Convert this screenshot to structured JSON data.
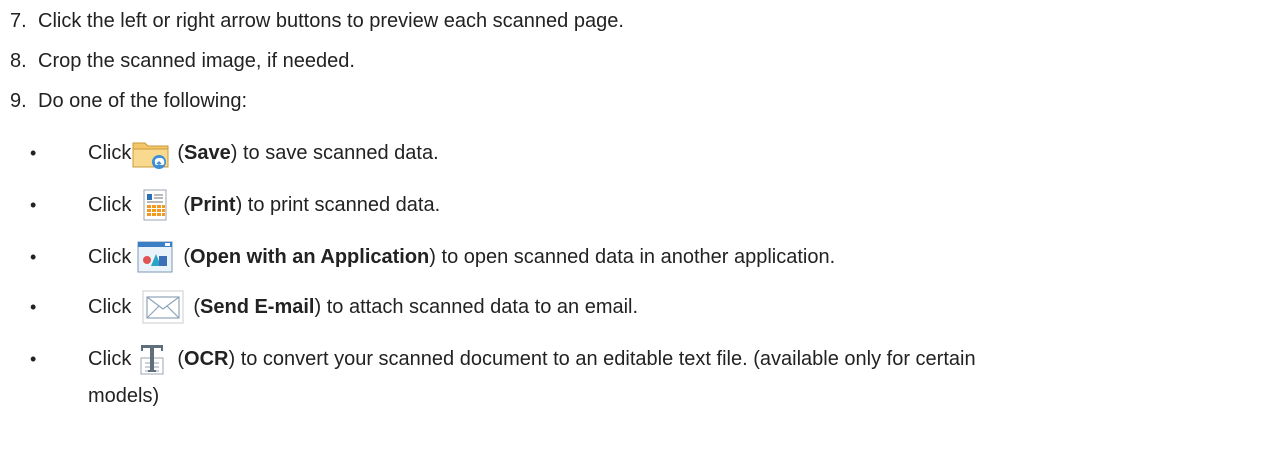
{
  "steps": [
    {
      "number": "7.",
      "text": "Click the left or right arrow buttons to preview each scanned page."
    },
    {
      "number": "8.",
      "text": "Crop the scanned image, if needed."
    },
    {
      "number": "9.",
      "text": "Do one of the following:"
    }
  ],
  "options": [
    {
      "bullet": "•",
      "click": "Click",
      "icon": "folder-save-icon",
      "open": "(",
      "name": "Save",
      "close": ")",
      "rest": " to save scanned data."
    },
    {
      "bullet": "•",
      "click": "Click",
      "icon": "print-icon",
      "open": "(",
      "name": "Print",
      "close": ")",
      "rest": " to print scanned data."
    },
    {
      "bullet": "•",
      "click": "Click",
      "icon": "open-application-icon",
      "open": "(",
      "name": "Open with an Application",
      "close": ")",
      "rest": " to open scanned data in another application."
    },
    {
      "bullet": "•",
      "click": "Click",
      "icon": "email-envelope-icon",
      "open": "(",
      "name": "Send E-mail",
      "close": ")",
      "rest": " to attach scanned data to an email."
    },
    {
      "bullet": "•",
      "click": "Click",
      "icon": "ocr-text-icon",
      "open": "(",
      "name": "OCR",
      "close": ")",
      "rest": " to convert your scanned document to an editable text file. (available only for certain",
      "continuation": "models)"
    }
  ]
}
